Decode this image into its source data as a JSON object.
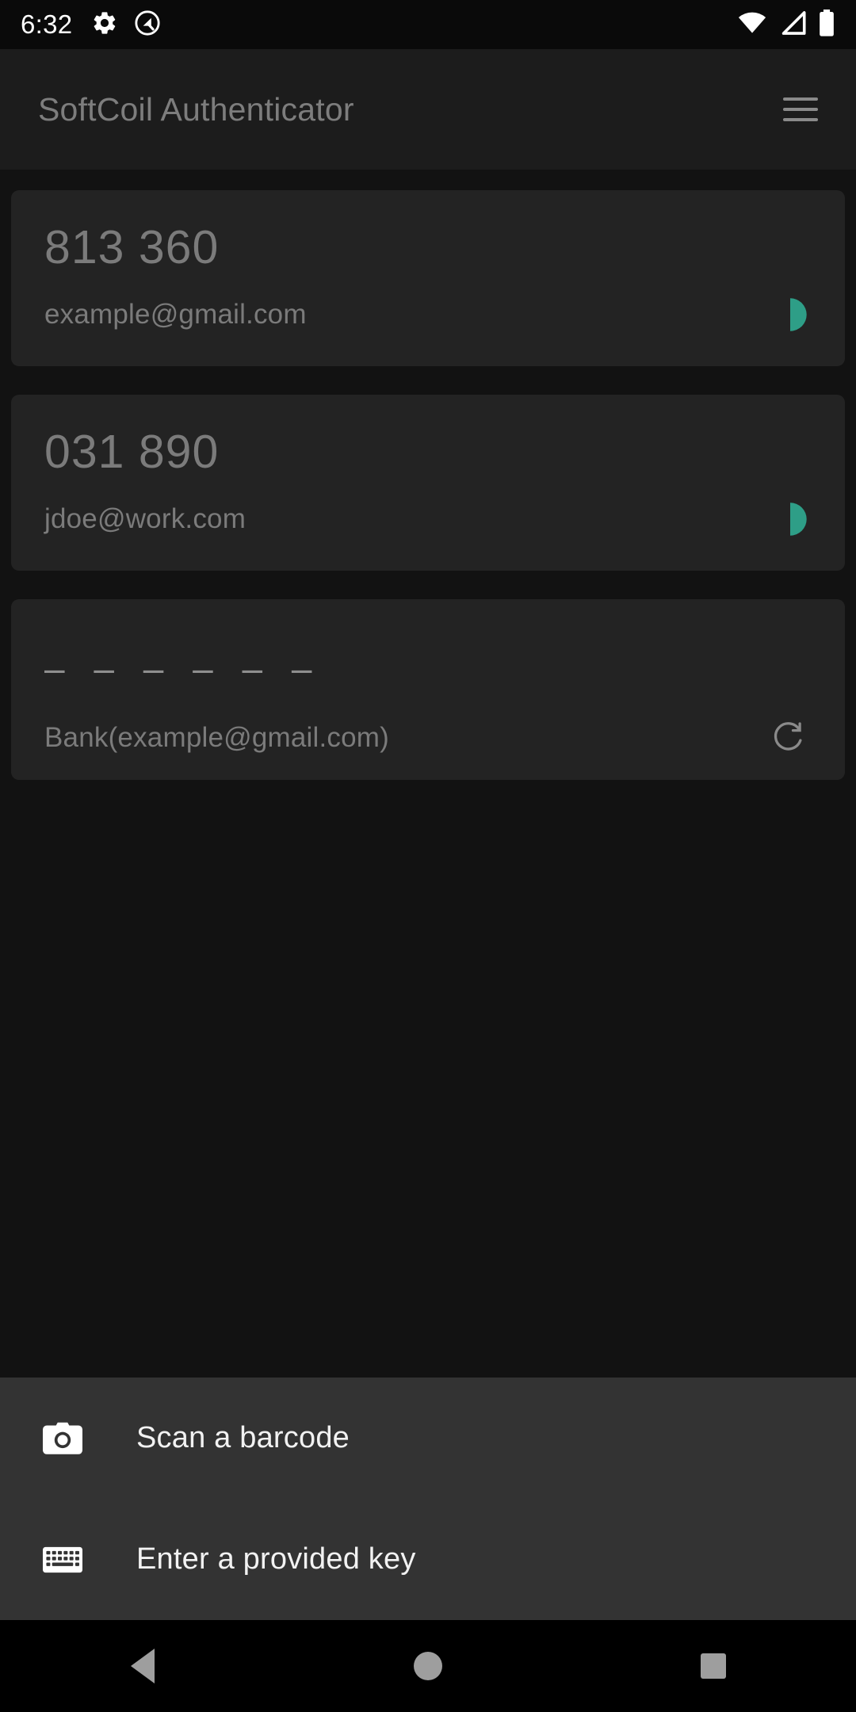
{
  "status_bar": {
    "time": "6:32",
    "left_icons": [
      "gear-icon",
      "android-q-icon"
    ],
    "right_icons": [
      "wifi-icon",
      "cellular-signal-icon",
      "battery-icon"
    ]
  },
  "app_bar": {
    "title": "SoftCoil Authenticator",
    "menu_icon": "hamburger-menu-icon"
  },
  "accounts": [
    {
      "code": "813 360",
      "label": "example@gmail.com",
      "trailing_icon": "countdown-pie-icon",
      "timer_fraction": 0.5
    },
    {
      "code": "031 890",
      "label": "jdoe@work.com",
      "trailing_icon": "countdown-pie-icon",
      "timer_fraction": 0.5
    },
    {
      "code": "– – – – – –",
      "label": "Bank(example@gmail.com)",
      "trailing_icon": "refresh-icon",
      "timer_fraction": null
    }
  ],
  "bottom_sheet": {
    "items": [
      {
        "label": "Scan a barcode",
        "icon": "camera-icon"
      },
      {
        "label": "Enter a provided key",
        "icon": "keyboard-icon"
      }
    ]
  },
  "nav_bar": {
    "back": "back-icon",
    "home": "home-icon",
    "recents": "recents-icon"
  },
  "colors": {
    "accent_teal": "#2e9e87",
    "card_bg": "#232323",
    "screen_bg": "#121212",
    "sheet_bg": "#333333",
    "dimmed_text": "#7b7b7b"
  }
}
